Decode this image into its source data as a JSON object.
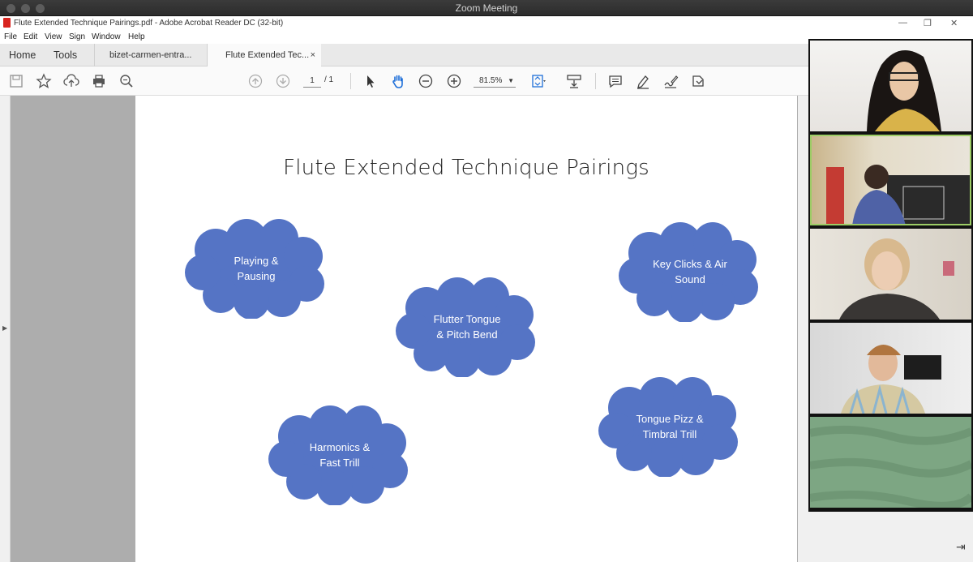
{
  "zoom": {
    "title": "Zoom Meeting"
  },
  "window": {
    "title": "Flute Extended Technique Pairings.pdf - Adobe Acrobat Reader DC (32-bit)"
  },
  "menu": [
    "File",
    "Edit",
    "View",
    "Sign",
    "Window",
    "Help"
  ],
  "tabs": {
    "home": "Home",
    "tools": "Tools",
    "doc1": "bizet-carmen-entra...",
    "doc2": "Flute Extended Tec...",
    "close": "×"
  },
  "toolbar": {
    "page_current": "1",
    "page_total": "/ 1",
    "zoom": "81.5%"
  },
  "slide": {
    "title": "Flute Extended Technique Pairings",
    "clouds": [
      {
        "line1": "Playing &",
        "line2": "Pausing"
      },
      {
        "line1": "Flutter Tongue",
        "line2": "& Pitch Bend"
      },
      {
        "line1": "Key Clicks & Air",
        "line2": "Sound"
      },
      {
        "line1": "Harmonics &",
        "line2": "Fast Trill"
      },
      {
        "line1": "Tongue Pizz &",
        "line2": "Timbral Trill"
      }
    ]
  },
  "colors": {
    "cloud": "#5574c5",
    "active_speaker": "#9ccc65",
    "pdf_red": "#d8241f"
  },
  "gallery": {
    "participants": 5,
    "active_index": 1
  }
}
